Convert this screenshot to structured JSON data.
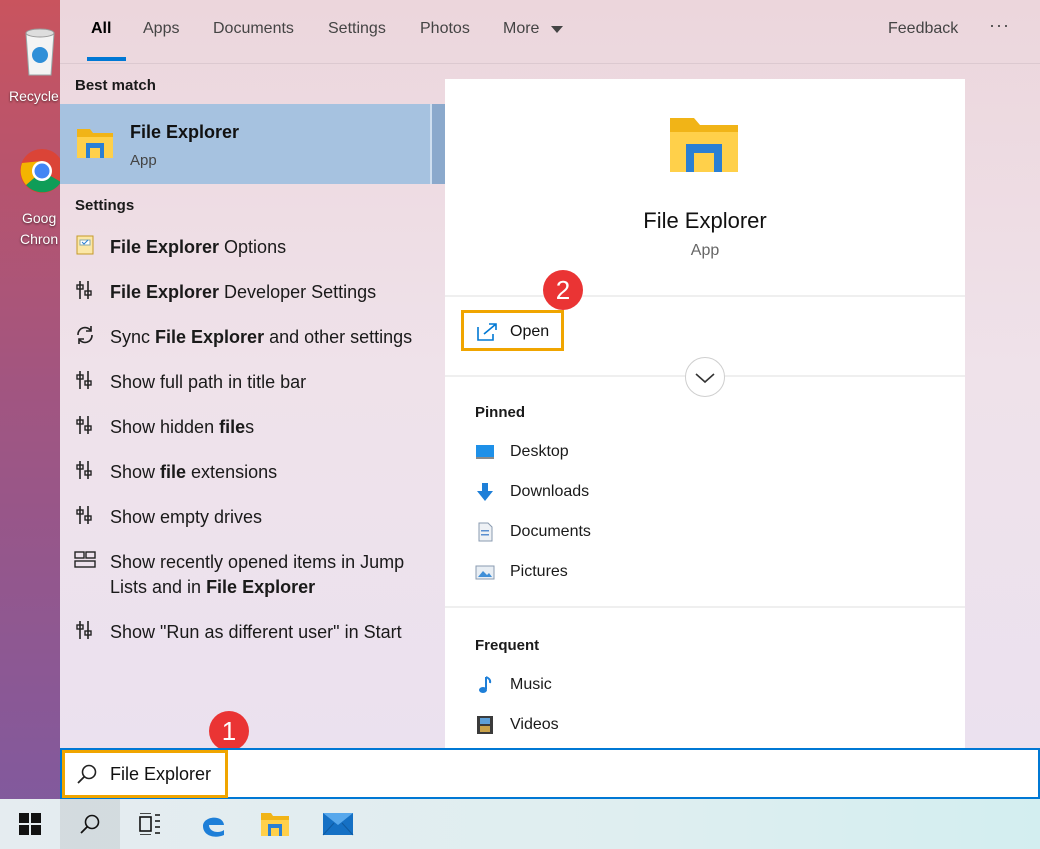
{
  "desktop": {
    "recycle_label": "Recycle",
    "chrome_label_1": "Goog",
    "chrome_label_2": "Chron"
  },
  "tabs": {
    "all": "All",
    "apps": "Apps",
    "documents": "Documents",
    "settings": "Settings",
    "photos": "Photos",
    "more": "More",
    "feedback": "Feedback",
    "overflow": "···"
  },
  "best_match": {
    "section": "Best match",
    "title": "File Explorer",
    "subtitle": "App"
  },
  "settings_section": "Settings",
  "settings_items": [
    {
      "pre": "",
      "bold": "File Explorer",
      "post": " Options",
      "icon": "folder-options-icon"
    },
    {
      "pre": "",
      "bold": "File Explorer",
      "post": " Developer Settings",
      "icon": "developer-settings-icon"
    },
    {
      "pre": "Sync ",
      "bold": "File Explorer",
      "post": " and other settings",
      "icon": "sync-icon"
    },
    {
      "pre": "Show full path in title bar",
      "bold": "",
      "post": "",
      "icon": "developer-settings-icon"
    },
    {
      "pre": "Show hidden ",
      "bold": "file",
      "post": "s",
      "icon": "developer-settings-icon"
    },
    {
      "pre": "Show ",
      "bold": "file",
      "post": " extensions",
      "icon": "developer-settings-icon"
    },
    {
      "pre": "Show empty drives",
      "bold": "",
      "post": "",
      "icon": "developer-settings-icon"
    },
    {
      "pre": "Show recently opened items in Jump Lists and in ",
      "bold": "File Explorer",
      "post": "",
      "icon": "taskbar-settings-icon"
    },
    {
      "pre": "Show \"Run as different user\" in Start",
      "bold": "",
      "post": "",
      "icon": "developer-settings-icon"
    }
  ],
  "detail": {
    "title": "File Explorer",
    "subtitle": "App",
    "open_label": "Open",
    "pinned_label": "Pinned",
    "pinned": [
      "Desktop",
      "Downloads",
      "Documents",
      "Pictures"
    ],
    "frequent_label": "Frequent",
    "frequent": [
      "Music",
      "Videos"
    ]
  },
  "callouts": {
    "one": "1",
    "two": "2"
  },
  "search": {
    "value": "File Explorer"
  },
  "colors": {
    "accent": "#0078d4",
    "highlight": "#f0a500",
    "badge": "#ea3434",
    "selected": "#a6c2e0"
  }
}
